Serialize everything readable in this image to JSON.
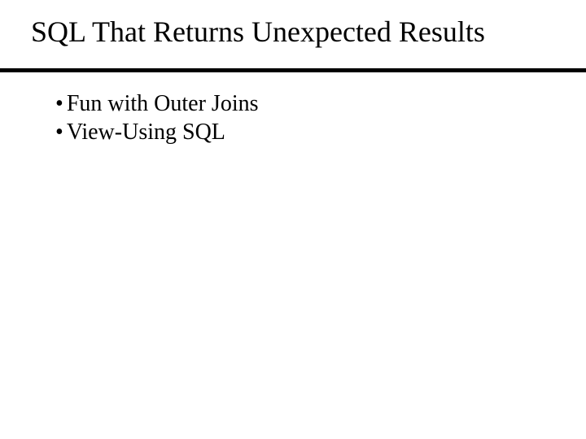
{
  "slide": {
    "title": "SQL That Returns Unexpected Results",
    "bullets": [
      "Fun with Outer Joins",
      "View-Using SQL"
    ]
  }
}
